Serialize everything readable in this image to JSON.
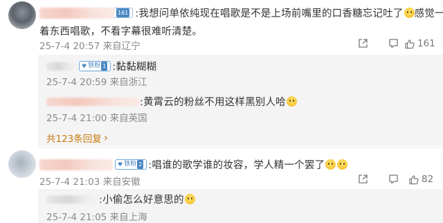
{
  "comments": [
    {
      "user_badge": "161",
      "text_line1": ":我想问单依纯现在唱歌是不是上场前嘴里的口香糖忘记吐了",
      "text_line1_tail": " 感觉一直含",
      "text_line2": "着东西唱歌，不看字幕很难听清楚。",
      "time": "25-7-4 20:57 来自辽宁",
      "like_count": "161",
      "replies": [
        {
          "badge_label": "铁粉",
          "badge_num": "1",
          "text": ":黏黏糊糊",
          "time": "25-7-4 20:59 来自浙江"
        },
        {
          "text": ":黄霄云的粉丝不用这样黑别人哈",
          "time": "25-7-4 21:00 来自英国"
        }
      ],
      "more_replies": "共123条回复",
      "more_replies_arrow": "›"
    },
    {
      "badge_label": "铁粉",
      "badge_num": "2",
      "text": ":唱谁的歌学谁的妆容，学人精一个罢了",
      "time": "25-7-4 21:03 来自安徽",
      "like_count": "82",
      "replies": [
        {
          "text": ":小偷怎么好意思的",
          "time": "25-7-4 21:05 来自上海"
        }
      ]
    }
  ],
  "icons": [
    "share-icon",
    "comment-icon",
    "like-icon",
    "fan-badge-icon",
    "emoji-icon"
  ]
}
